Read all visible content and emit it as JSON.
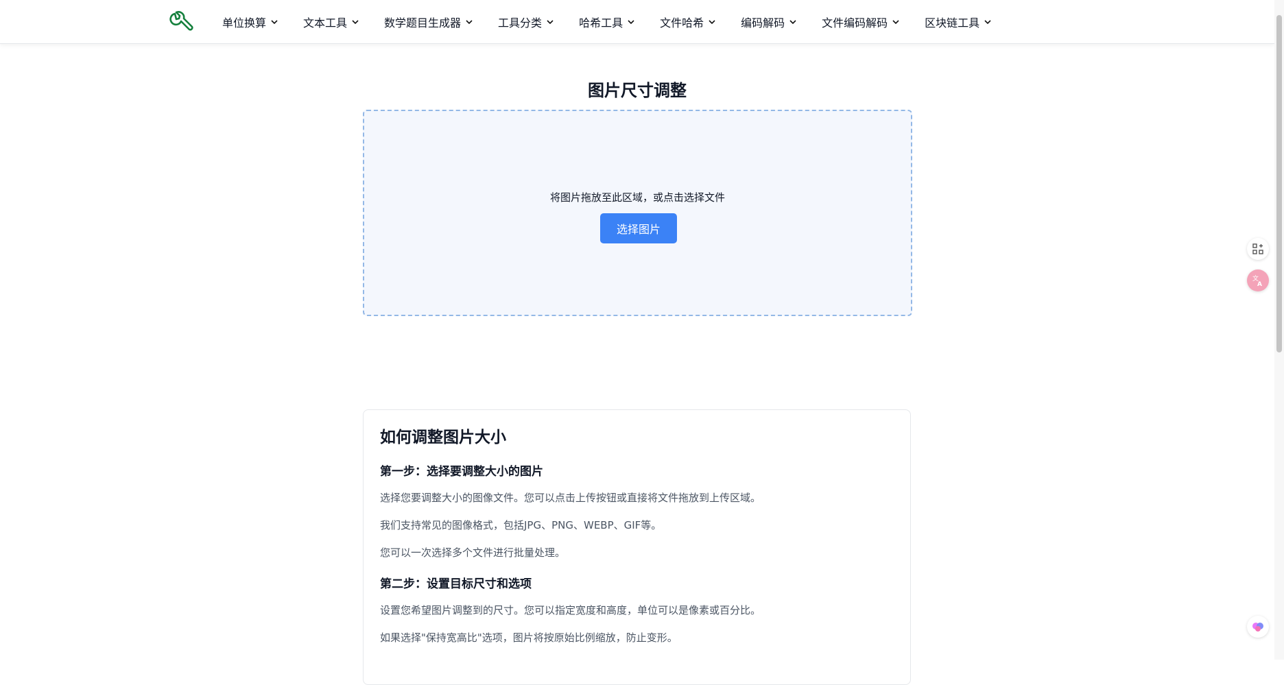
{
  "nav": {
    "items": [
      {
        "label": "单位换算"
      },
      {
        "label": "文本工具"
      },
      {
        "label": "数学题目生成器"
      },
      {
        "label": "工具分类"
      },
      {
        "label": "哈希工具"
      },
      {
        "label": "文件哈希"
      },
      {
        "label": "编码解码"
      },
      {
        "label": "文件编码解码"
      },
      {
        "label": "区块链工具"
      }
    ]
  },
  "main": {
    "title": "图片尺寸调整",
    "dropzone": {
      "text": "将图片拖放至此区域，或点击选择文件",
      "button_label": "选择图片"
    }
  },
  "howto": {
    "title": "如何调整图片大小",
    "step1": {
      "heading": "第一步：选择要调整大小的图片",
      "p1": "选择您要调整大小的图像文件。您可以点击上传按钮或直接将文件拖放到上传区域。",
      "p2": "我们支持常见的图像格式，包括JPG、PNG、WEBP、GIF等。",
      "p3": "您可以一次选择多个文件进行批量处理。"
    },
    "step2": {
      "heading": "第二步：设置目标尺寸和选项",
      "p1": "设置您希望图片调整到的尺寸。您可以指定宽度和高度，单位可以是像素或百分比。",
      "p2": "如果选择\"保持宽高比\"选项，图片将按原始比例缩放，防止变形。"
    }
  },
  "colors": {
    "accent": "#3b82f6",
    "logo": "#15803d",
    "dropzone_border": "#93b8e6",
    "dropzone_bg": "#f4f7fd"
  }
}
